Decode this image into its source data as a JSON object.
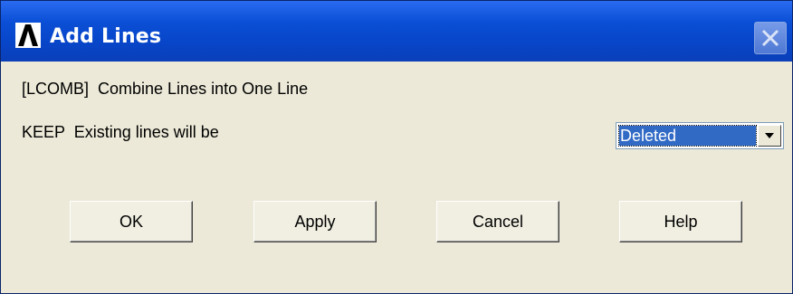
{
  "window": {
    "title": "Add Lines",
    "icon": "ansys-logo-icon",
    "close_icon": "close-icon"
  },
  "form": {
    "command_label": "[LCOMB]  Combine Lines into One Line",
    "keep_label": "KEEP  Existing lines will be",
    "keep_select": {
      "value": "Deleted",
      "arrow_icon": "chevron-down-icon"
    }
  },
  "buttons": {
    "ok": "OK",
    "apply": "Apply",
    "cancel": "Cancel",
    "help": "Help"
  },
  "colors": {
    "titlebar": "#0845c8",
    "selection": "#316ac5",
    "dialog_bg": "#ece9d8"
  }
}
